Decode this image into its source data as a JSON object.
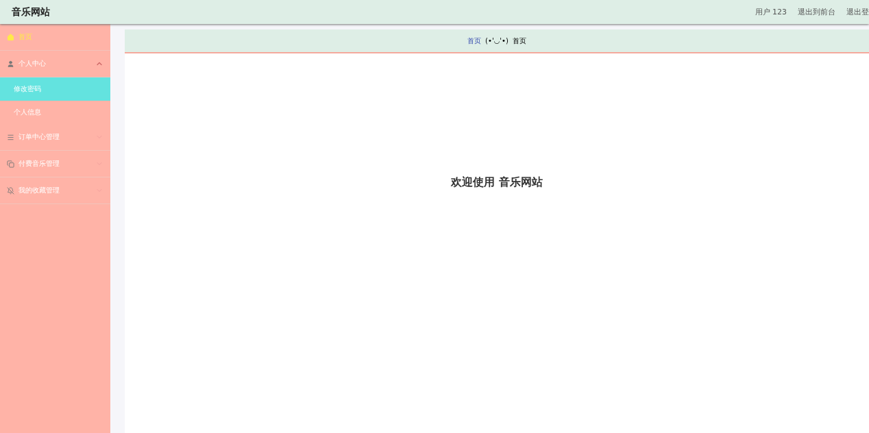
{
  "header": {
    "title": "音乐网站",
    "links": [
      "用户 123",
      "退出到前台",
      "退出登"
    ]
  },
  "sidebar": {
    "items": [
      {
        "label": "首页",
        "selected": true
      },
      {
        "label": "个人中心",
        "expanded": true,
        "children": [
          {
            "label": "修改密码",
            "selected": true
          },
          {
            "label": "个人信息",
            "selected": false
          }
        ]
      },
      {
        "label": "订单中心管理",
        "expanded": false
      },
      {
        "label": "付费音乐管理",
        "expanded": false
      },
      {
        "label": "我的收藏管理",
        "expanded": false
      }
    ]
  },
  "breadcrumb": {
    "link": "首页",
    "separator": "(•'◡'•)",
    "current": "首页"
  },
  "welcome": "欢迎使用 音乐网站"
}
